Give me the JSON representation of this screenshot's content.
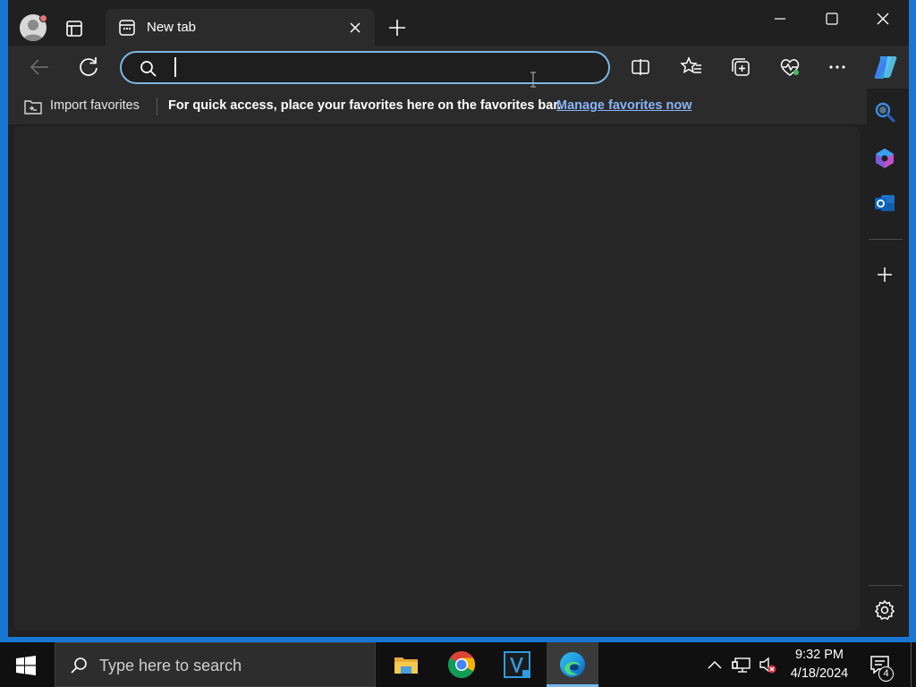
{
  "browser": {
    "tab": {
      "title": "New tab"
    },
    "address_bar": {
      "value": "",
      "placeholder": ""
    },
    "favorites_bar": {
      "import_label": "Import favorites",
      "message": "For quick access, place your favorites here on the favorites bar.",
      "link": "Manage favorites now"
    },
    "colors": {
      "address_focus_border": "#7bb6e3",
      "link": "#8ab4f8",
      "content_bg": "#262626"
    }
  },
  "taskbar": {
    "search_placeholder": "Type here to search",
    "apps": [
      "file-explorer",
      "google-chrome",
      "vs-app",
      "microsoft-edge"
    ],
    "active_app": "microsoft-edge",
    "clock": {
      "time": "9:32 PM",
      "date": "4/18/2024"
    },
    "notification_count": "4"
  },
  "desktop": {
    "background": "#1877d2"
  }
}
